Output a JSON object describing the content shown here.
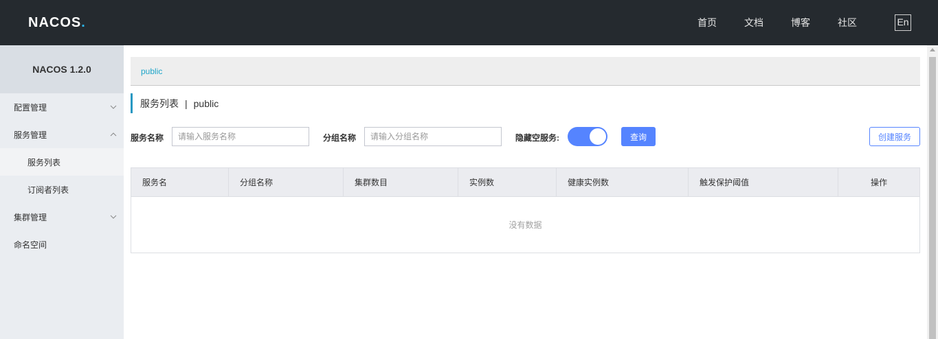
{
  "topbar": {
    "logo": {
      "prefix": "NAC",
      "o": "O",
      "suffix": "S",
      "dot": "."
    },
    "nav": [
      "首页",
      "文档",
      "博客",
      "社区"
    ],
    "lang": "En"
  },
  "sidebar": {
    "title": "NACOS 1.2.0",
    "items": [
      {
        "label": "配置管理",
        "chevron": "down"
      },
      {
        "label": "服务管理",
        "chevron": "up"
      },
      {
        "label": "服务列表"
      },
      {
        "label": "订阅者列表"
      },
      {
        "label": "集群管理",
        "chevron": "down"
      },
      {
        "label": "命名空间"
      }
    ]
  },
  "breadcrumb": {
    "namespace": "public"
  },
  "page": {
    "title": "服务列表",
    "separator": "|",
    "namespace": "public"
  },
  "filters": {
    "service_name_label": "服务名称",
    "service_name_placeholder": "请输入服务名称",
    "group_name_label": "分组名称",
    "group_name_placeholder": "请输入分组名称",
    "hide_empty_label": "隐藏空服务:",
    "hide_empty_on": true,
    "query_label": "查询",
    "create_label": "创建服务"
  },
  "table": {
    "columns": [
      "服务名",
      "分组名称",
      "集群数目",
      "实例数",
      "健康实例数",
      "触发保护阈值",
      "操作"
    ],
    "empty_text": "没有数据"
  },
  "colors": {
    "accent": "#5584ff",
    "topbar": "#252a2f",
    "sidebar": "#eaedf1",
    "breadcrumb_text": "#1ea5c9"
  }
}
